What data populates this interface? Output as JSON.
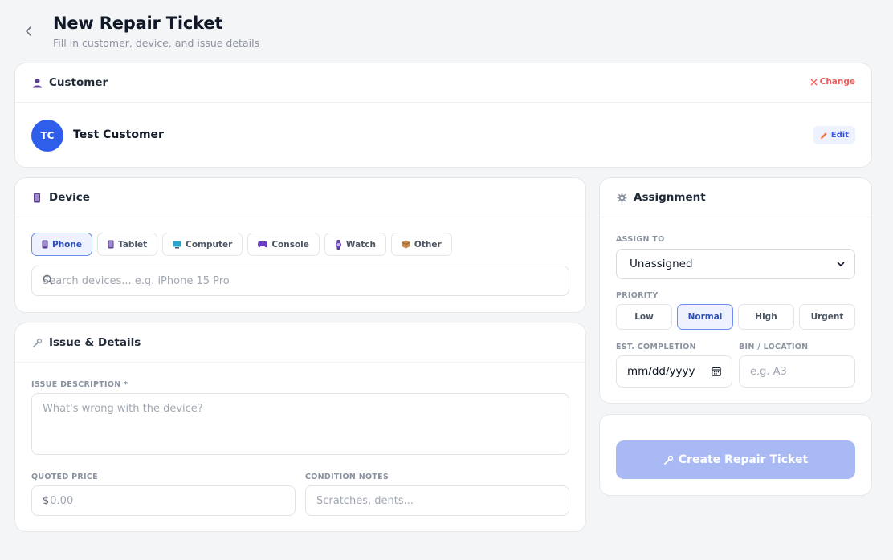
{
  "header": {
    "title": "New Repair Ticket",
    "subtitle": "Fill in customer, device, and issue details"
  },
  "customer": {
    "section_title": "Customer",
    "change_label": "Change",
    "initials": "TC",
    "name": "Test Customer",
    "edit_label": "Edit"
  },
  "device": {
    "section_title": "Device",
    "types": [
      "Phone",
      "Tablet",
      "Computer",
      "Console",
      "Watch",
      "Other"
    ],
    "selected": "Phone",
    "search_placeholder": "Search devices... e.g. iPhone 15 Pro"
  },
  "issue": {
    "section_title": "Issue & Details",
    "description_label": "ISSUE DESCRIPTION *",
    "description_placeholder": "What's wrong with the device?",
    "price_label": "QUOTED PRICE",
    "price_placeholder": "0.00",
    "price_prefix": "$",
    "condition_label": "CONDITION NOTES",
    "condition_placeholder": "Scratches, dents..."
  },
  "assignment": {
    "section_title": "Assignment",
    "assign_label": "ASSIGN TO",
    "assign_value": "Unassigned",
    "priority_label": "PRIORITY",
    "priorities": [
      "Low",
      "Normal",
      "High",
      "Urgent"
    ],
    "selected_priority": "Normal",
    "completion_label": "EST. COMPLETION",
    "completion_value": "mm/dd/yyyy",
    "bin_label": "BIN / LOCATION",
    "bin_placeholder": "e.g. A3"
  },
  "actions": {
    "create_label": "Create Repair Ticket"
  },
  "colors": {
    "accent": "#2f5fe8",
    "danger": "#ef5b5b",
    "button_disabled": "#a9b9f4"
  }
}
